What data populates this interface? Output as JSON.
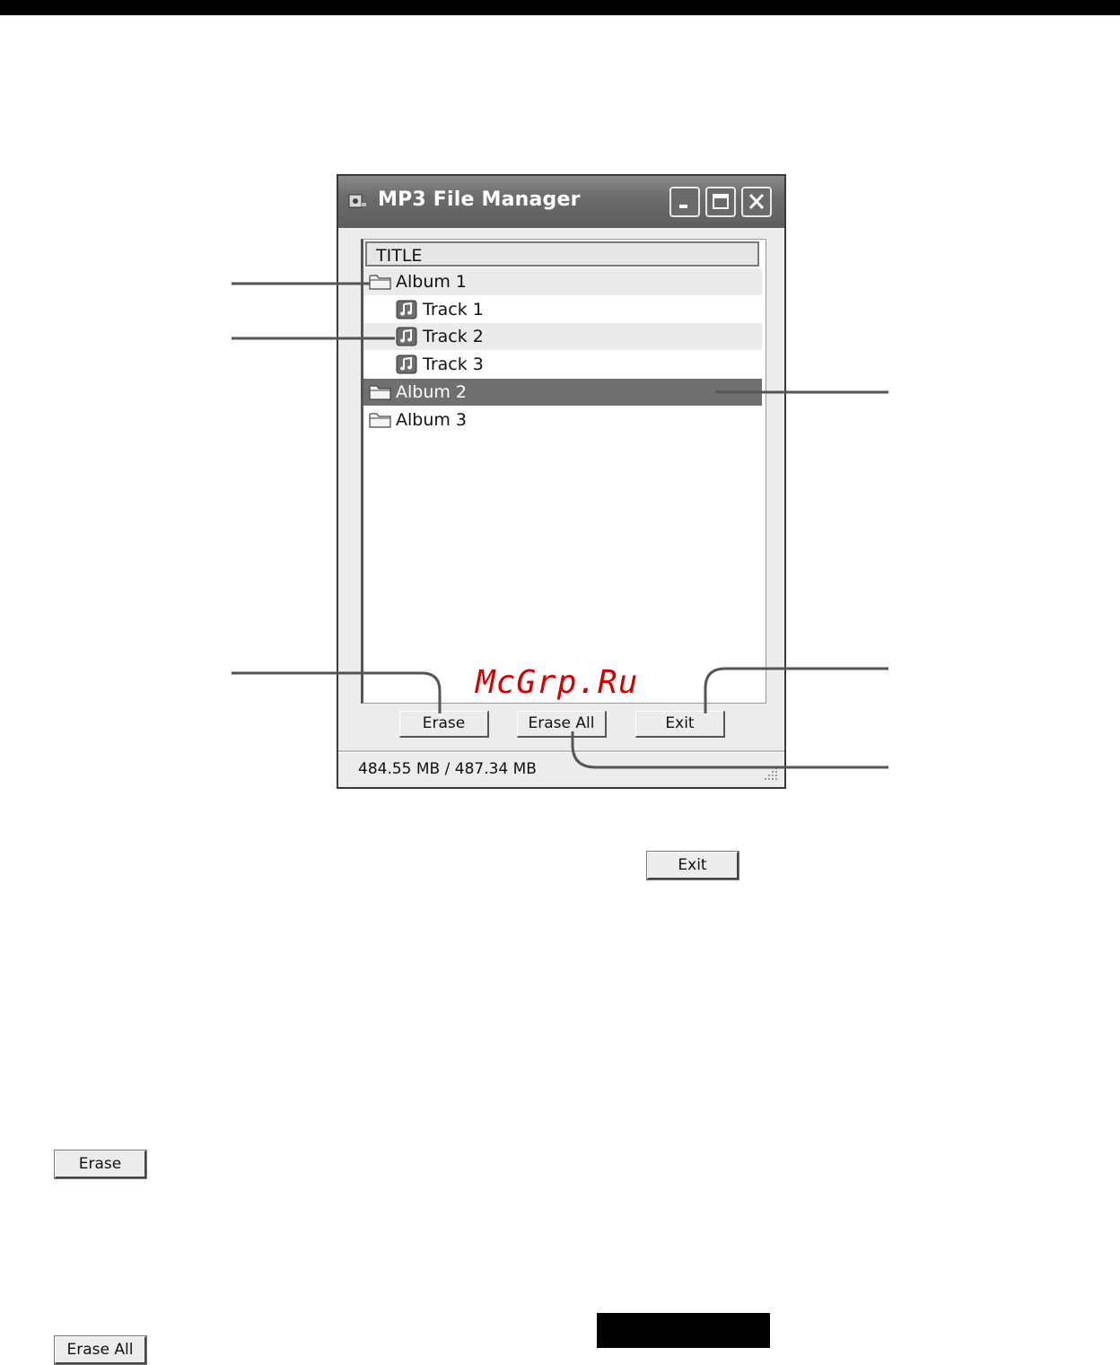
{
  "window": {
    "title": "MP3 File Manager",
    "column_header": "TITLE",
    "rows": [
      {
        "type": "folder",
        "label": "Album 1",
        "indent": 0,
        "selected": false,
        "alt": true
      },
      {
        "type": "track",
        "label": "Track 1",
        "indent": 1,
        "selected": false,
        "alt": false
      },
      {
        "type": "track",
        "label": "Track 2",
        "indent": 1,
        "selected": false,
        "alt": true
      },
      {
        "type": "track",
        "label": "Track 3",
        "indent": 1,
        "selected": false,
        "alt": false
      },
      {
        "type": "folder",
        "label": "Album 2",
        "indent": 0,
        "selected": true,
        "alt": false
      },
      {
        "type": "folder",
        "label": "Album 3",
        "indent": 0,
        "selected": false,
        "alt": false
      }
    ],
    "buttons": {
      "erase": "Erase",
      "erase_all": "Erase All",
      "exit": "Exit"
    },
    "status": "484.55 MB / 487.34 MB"
  },
  "watermark": "McGrp.Ru",
  "standalone_buttons": {
    "exit": "Exit",
    "erase": "Erase",
    "erase_all": "Erase All"
  },
  "colors": {
    "titlebar": "#6c6c6c",
    "selected_row": "#707070",
    "watermark": "#d40000"
  }
}
